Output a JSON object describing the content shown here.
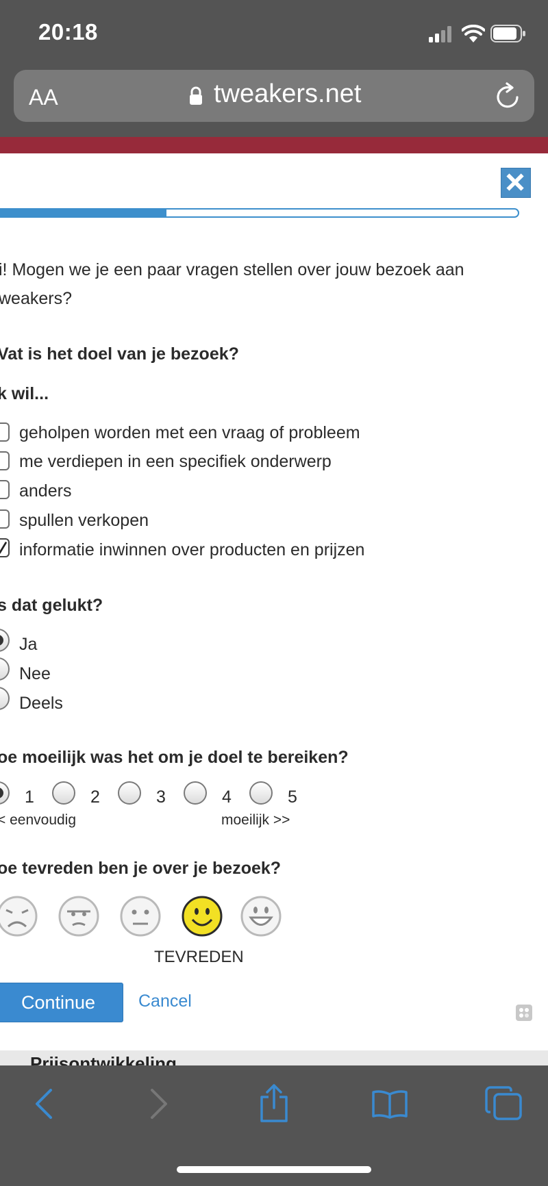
{
  "status_bar": {
    "time": "20:18"
  },
  "browser": {
    "text_size_label": "AA",
    "domain": "tweakers.net"
  },
  "survey": {
    "progress_percent": 33,
    "intro_line1": "i! Mogen we je een paar vragen stellen over jouw bezoek aan",
    "intro_line2": "weakers?",
    "q1": {
      "title": "Vat is het doel van je bezoek?",
      "subtitle": "k wil...",
      "options": [
        {
          "label": "geholpen worden met een vraag of probleem",
          "checked": false
        },
        {
          "label": "me verdiepen in een specifiek onderwerp",
          "checked": false
        },
        {
          "label": "anders",
          "checked": false
        },
        {
          "label": "spullen verkopen",
          "checked": false
        },
        {
          "label": "informatie inwinnen over producten en prijzen",
          "checked": true
        }
      ]
    },
    "q2": {
      "title": "s dat gelukt?",
      "options": [
        {
          "label": "Ja",
          "selected": true
        },
        {
          "label": "Nee",
          "selected": false
        },
        {
          "label": "Deels",
          "selected": false
        }
      ]
    },
    "q3": {
      "title": "oe moeilijk was het om je doel te bereiken?",
      "scale": [
        "1",
        "2",
        "3",
        "4",
        "5"
      ],
      "selected": "1",
      "low_label": "< eenvoudig",
      "high_label": "moeilijk >>"
    },
    "q4": {
      "title": "oe tevreden ben je over je bezoek?",
      "selected_index": 3,
      "selected_label": "TEVREDEN",
      "faces": [
        "very-unhappy-face-icon",
        "unhappy-face-icon",
        "neutral-face-icon",
        "happy-face-icon",
        "very-happy-face-icon"
      ]
    },
    "continue_label": "Continue",
    "cancel_label": "Cancel"
  },
  "behind_page": {
    "heading": "Prijsontwikkeling"
  },
  "colors": {
    "accent": "#3a8ad0",
    "brand_band": "#972a3a",
    "chrome": "#545454",
    "selected_face": "#f2e024"
  }
}
